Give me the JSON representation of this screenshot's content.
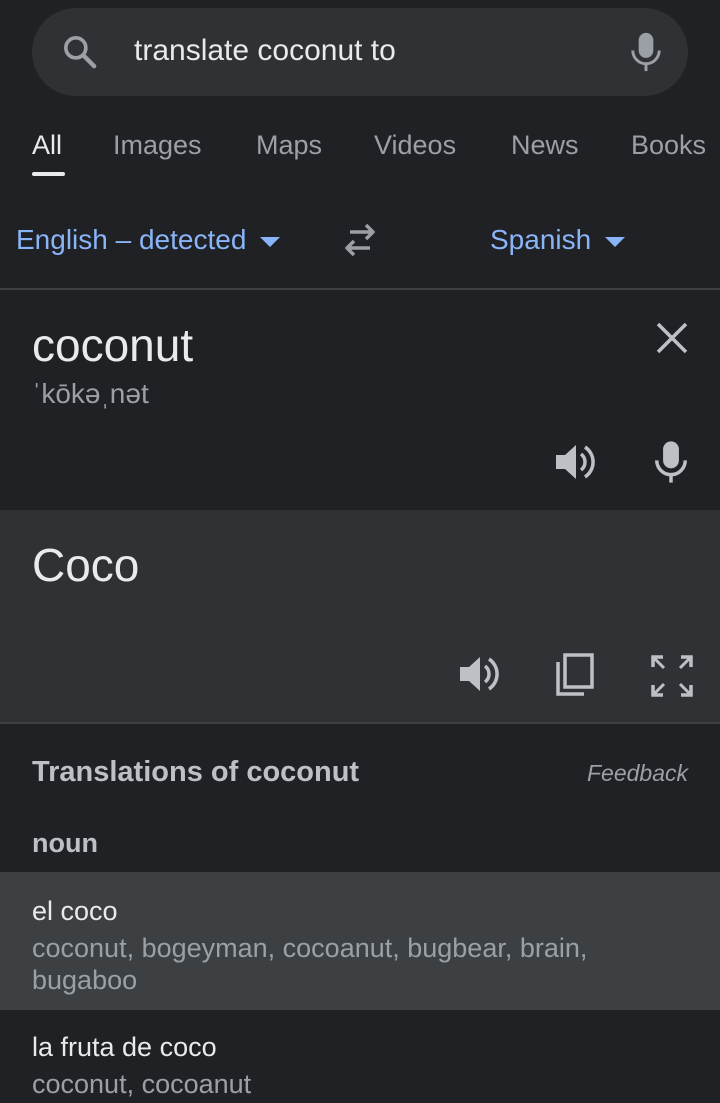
{
  "search": {
    "query": "translate coconut to"
  },
  "tabs": [
    {
      "label": "All",
      "active": true
    },
    {
      "label": "Images",
      "active": false
    },
    {
      "label": "Maps",
      "active": false
    },
    {
      "label": "Videos",
      "active": false
    },
    {
      "label": "News",
      "active": false
    },
    {
      "label": "Books",
      "active": false
    }
  ],
  "translator": {
    "source_lang": "English – detected",
    "target_lang": "Spanish",
    "source_text": "coconut",
    "phonetic": "ˈkōkəˌnət",
    "target_text": "Coco"
  },
  "translations": {
    "heading": "Translations of coconut",
    "feedback": "Feedback",
    "part_of_speech": "noun",
    "entries": [
      {
        "word": "el coco",
        "synonyms": "coconut, bogeyman, cocoanut, bugbear, brain, bugaboo"
      },
      {
        "word": "la fruta de coco",
        "synonyms": "coconut, cocoanut"
      }
    ]
  },
  "colors": {
    "background": "#202124",
    "surface": "#303134",
    "link": "#8ab4f8",
    "highlight": "#3c4043"
  }
}
